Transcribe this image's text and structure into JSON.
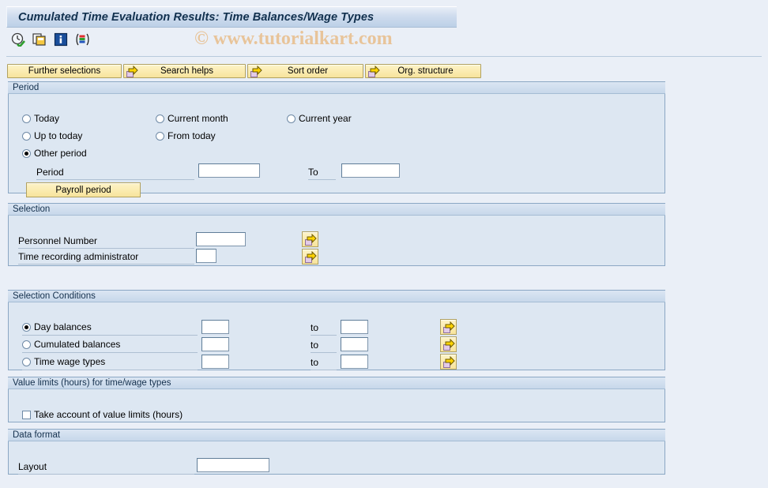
{
  "window": {
    "title": "Cumulated Time Evaluation Results: Time Balances/Wage Types"
  },
  "watermark": {
    "text": "© www.tutorialkart.com",
    "color": "#e8c49a"
  },
  "toolbar": {
    "icons": [
      {
        "name": "execute-clock-icon",
        "title": "Execute"
      },
      {
        "name": "copy-variant-icon",
        "title": "Get Variant"
      },
      {
        "name": "info-icon",
        "title": "Information"
      },
      {
        "name": "multiple-selection-icon",
        "title": "Multiple selection"
      }
    ]
  },
  "action_buttons": [
    {
      "label": "Further selections",
      "icon": null
    },
    {
      "label": "Search helps",
      "icon": "arrow-right-icon"
    },
    {
      "label": "Sort order",
      "icon": "arrow-right-icon"
    },
    {
      "label": "Org. structure",
      "icon": "arrow-right-icon"
    }
  ],
  "period": {
    "title": "Period",
    "options": [
      {
        "label": "Today",
        "selected": false
      },
      {
        "label": "Current month",
        "selected": false
      },
      {
        "label": "Current year",
        "selected": false
      },
      {
        "label": "Up to today",
        "selected": false
      },
      {
        "label": "From today",
        "selected": false
      },
      {
        "label": "Other period",
        "selected": true
      }
    ],
    "period_label": "Period",
    "period_value": "",
    "to_label": "To",
    "to_value": "",
    "payroll_button": "Payroll period"
  },
  "selection": {
    "title": "Selection",
    "rows": [
      {
        "label": "Personnel Number",
        "value": ""
      },
      {
        "label": "Time recording administrator",
        "value": ""
      }
    ],
    "multi_select_icon": "arrow-right-icon"
  },
  "selection_conditions": {
    "title": "Selection Conditions",
    "to_label": "to",
    "rows": [
      {
        "label": "Day balances",
        "selected": true,
        "from": "",
        "to": ""
      },
      {
        "label": "Cumulated balances",
        "selected": false,
        "from": "",
        "to": ""
      },
      {
        "label": "Time wage types",
        "selected": false,
        "from": "",
        "to": ""
      }
    ],
    "multi_select_icon": "arrow-right-icon"
  },
  "value_limits": {
    "title": "Value limits (hours) for time/wage types",
    "checkbox_label": "Take account of value limits (hours)",
    "checked": false
  },
  "data_format": {
    "title": "Data format",
    "layout_label": "Layout",
    "layout_value": ""
  }
}
